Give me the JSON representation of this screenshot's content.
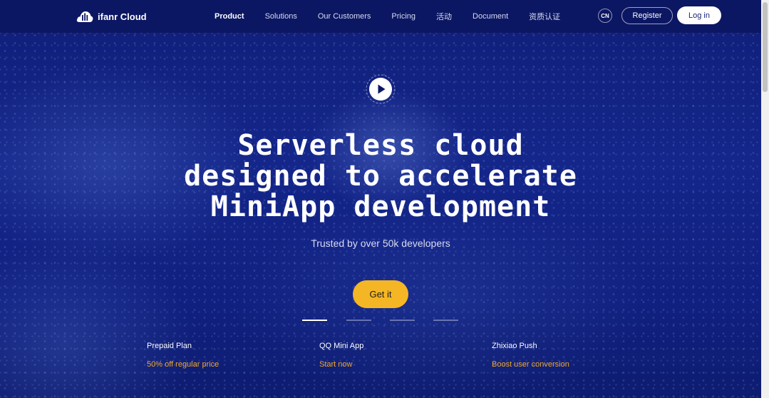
{
  "brand": {
    "name": "ifanr Cloud"
  },
  "nav": {
    "items": [
      {
        "label": "Product",
        "active": true
      },
      {
        "label": "Solutions",
        "active": false
      },
      {
        "label": "Our Customers",
        "active": false
      },
      {
        "label": "Pricing",
        "active": false
      },
      {
        "label": "活动",
        "active": false
      },
      {
        "label": "Document",
        "active": false
      },
      {
        "label": "资质认证",
        "active": false
      }
    ],
    "lang": "CN",
    "register": "Register",
    "login": "Log in"
  },
  "hero": {
    "headline": [
      "Serverless cloud",
      "designed to accelerate",
      "MiniApp development"
    ],
    "subtitle": "Trusted by over 50k developers",
    "cta": "Get it",
    "slides": {
      "count": 4,
      "active": 0
    }
  },
  "promos": [
    {
      "title": "Prepaid Plan",
      "link": "50% off regular price"
    },
    {
      "title": "QQ Mini App",
      "link": "Start now"
    },
    {
      "title": "Zhixiao Push",
      "link": "Boost user conversion"
    }
  ],
  "colors": {
    "nav_bg": "#0c1763",
    "hero_bg": "#14268a",
    "accent": "#f5b625",
    "promo_link": "#f0a828"
  }
}
